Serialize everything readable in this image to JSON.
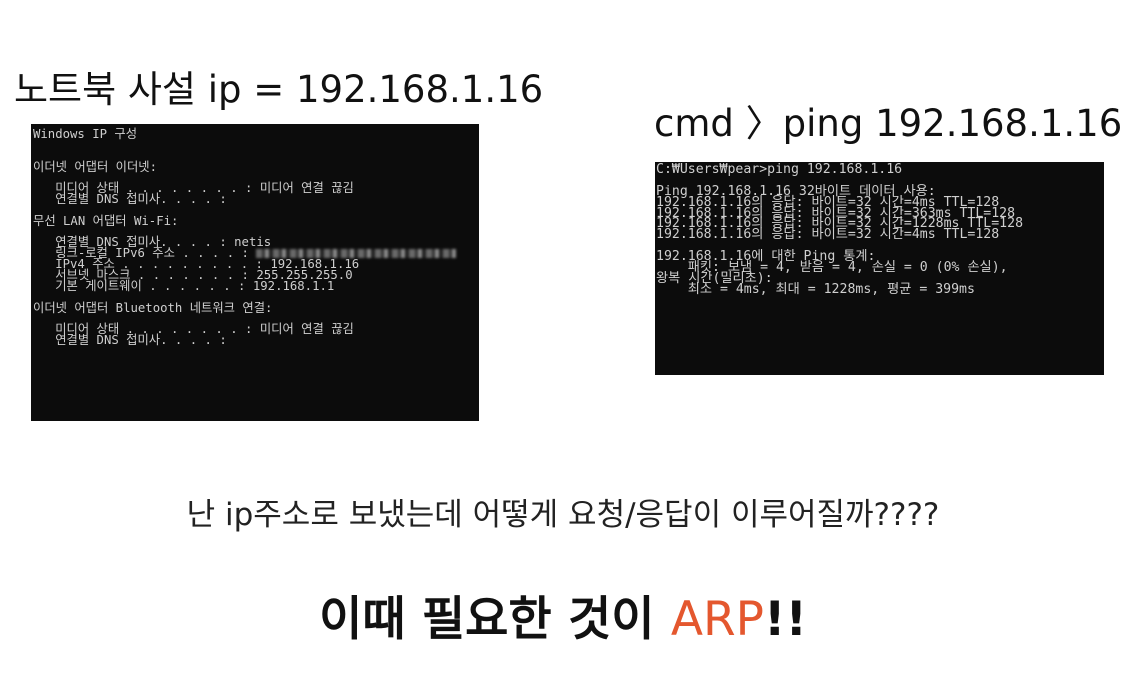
{
  "slide": {
    "left_heading": "노트북 사설 ip = 192.168.1.16",
    "right_heading": "cmd 〉ping 192.168.1.16",
    "question": "난 ip주소로 보냈는데 어떻게 요청/응답이 이루어질까????",
    "conclusion": {
      "prefix": "이때 필요한 것이 ",
      "highlight": "ARP",
      "suffix": "!!",
      "highlight_color": "#e4572e"
    }
  },
  "ipconfig_terminal": {
    "lines": [
      "Windows IP 구성",
      "",
      "",
      "이더넷 어댑터 이더넷:",
      "",
      "   미디어 상태 . . . . . . . . : 미디어 연결 끊김",
      "   연결별 DNS 접미사. . . . :",
      "",
      "무선 LAN 어댑터 Wi-Fi:",
      "",
      "   연결별 DNS 접미사. . . . : netis",
      "   링크-로컬 IPv6 주소 . . . . :",
      "   IPv4 주소 . . . . . . . . . : 192.168.1.16",
      "   서브넷 마스크 . . . . . . . : 255.255.255.0",
      "   기본 게이트웨이 . . . . . . : 192.168.1.1",
      "",
      "이더넷 어댑터 Bluetooth 네트워크 연결:",
      "",
      "   미디어 상태 . . . . . . . . : 미디어 연결 끊김",
      "   연결별 DNS 접미사. . . . :"
    ]
  },
  "ping_terminal": {
    "lines": [
      "C:₩Users₩pear>ping 192.168.1.16",
      "",
      "Ping 192.168.1.16 32바이트 데이터 사용:",
      "192.168.1.16의 응답: 바이트=32 시간=4ms TTL=128",
      "192.168.1.16의 응답: 바이트=32 시간=363ms TTL=128",
      "192.168.1.16의 응답: 바이트=32 시간=1228ms TTL=128",
      "192.168.1.16의 응답: 바이트=32 시간=4ms TTL=128",
      "",
      "192.168.1.16에 대한 Ping 통계:",
      "    패킷: 보냄 = 4, 받음 = 4, 손실 = 0 (0% 손실),",
      "왕복 시간(밀리초):",
      "    최소 = 4ms, 최대 = 1228ms, 평균 = 399ms"
    ]
  }
}
